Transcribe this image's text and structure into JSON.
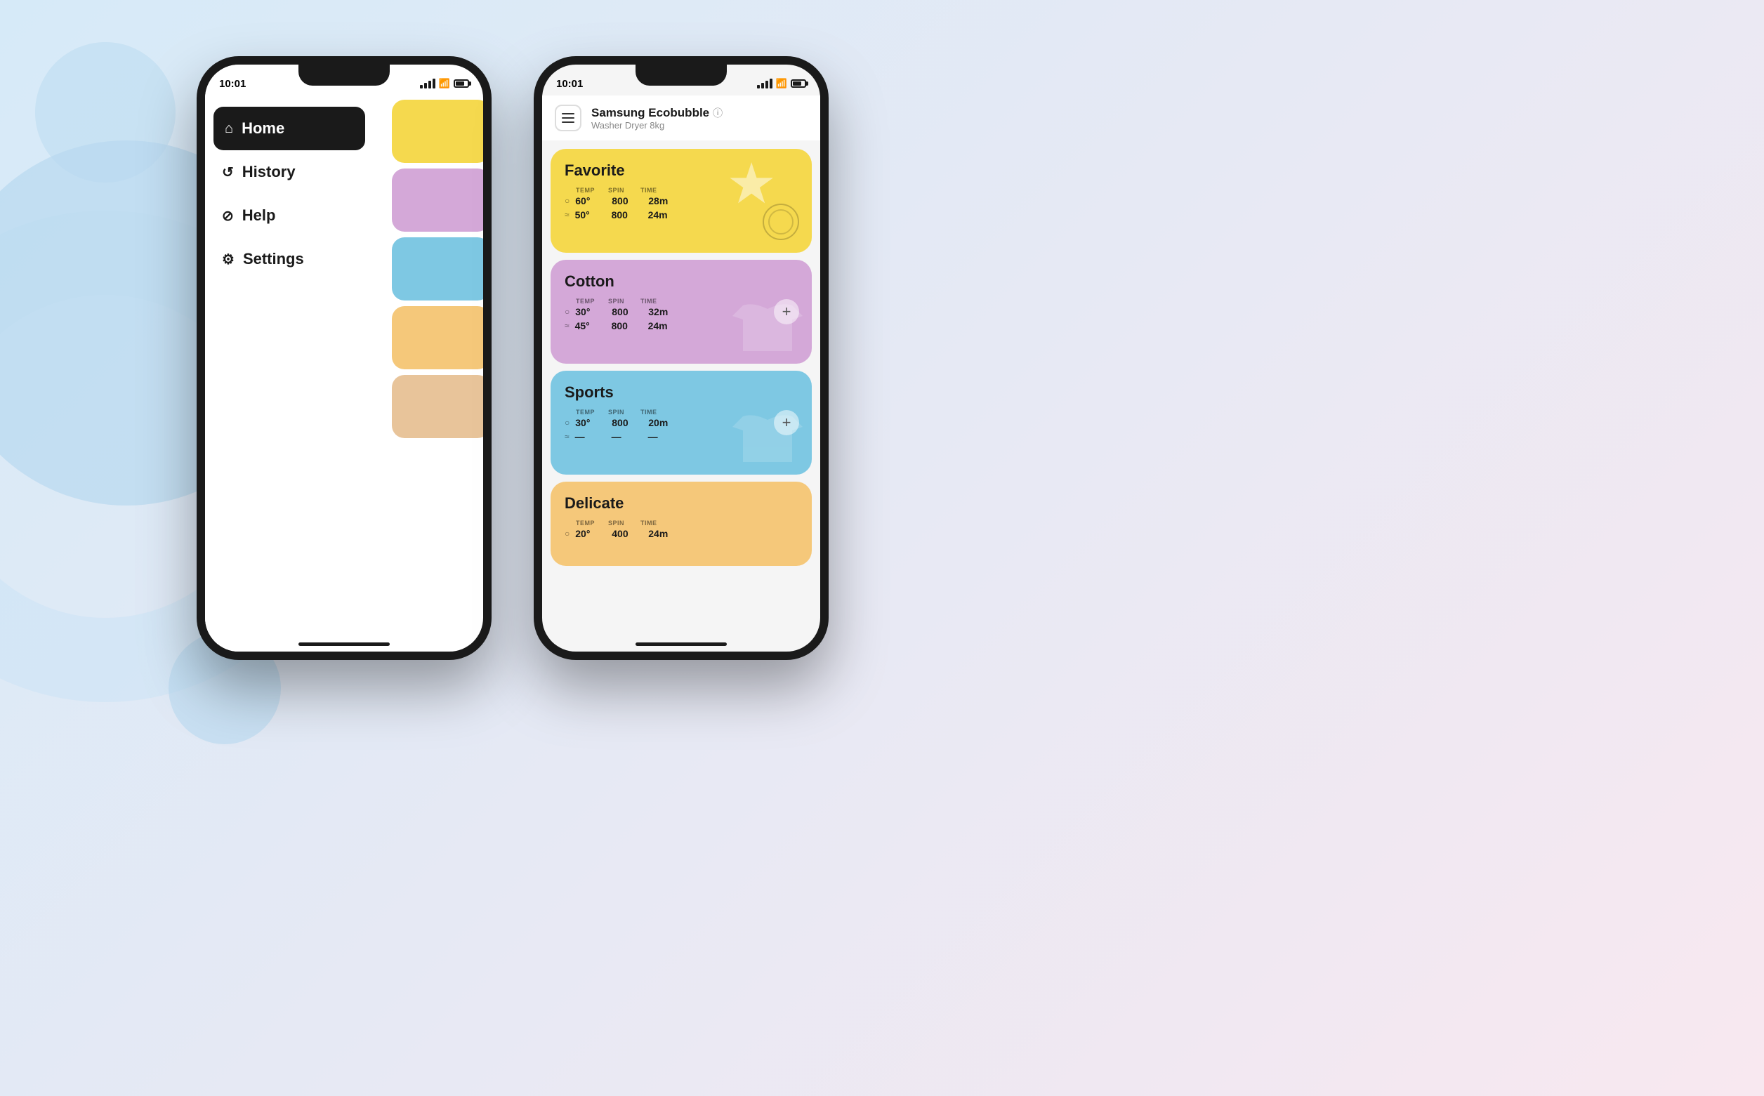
{
  "background": {
    "gradient_start": "#d6eaf8",
    "gradient_end": "#f8e8f0"
  },
  "phone1": {
    "status_bar": {
      "time": "10:01",
      "signal": "●●●",
      "wifi": "wifi",
      "battery": "battery"
    },
    "menu": {
      "items": [
        {
          "id": "home",
          "label": "Home",
          "icon": "⌂",
          "active": true
        },
        {
          "id": "history",
          "label": "History",
          "icon": "↺",
          "active": false
        },
        {
          "id": "help",
          "label": "Help",
          "icon": "?",
          "active": false
        },
        {
          "id": "settings",
          "label": "Settings",
          "icon": "⚙",
          "active": false
        }
      ]
    }
  },
  "phone2": {
    "status_bar": {
      "time": "10:01"
    },
    "header": {
      "device_name": "Samsung Ecobubble",
      "device_type": "Washer Dryer 8kg",
      "menu_label": "menu"
    },
    "cards": [
      {
        "id": "favorite",
        "title": "Favorite",
        "color": "#f5d94e",
        "stat_headers": [
          "TEMP",
          "SPIN",
          "TIME"
        ],
        "rows": [
          {
            "icon": "○",
            "temp": "60°",
            "spin": "800",
            "time": "28m"
          },
          {
            "icon": "≈",
            "temp": "50°",
            "spin": "800",
            "time": "24m"
          }
        ],
        "action": "spin-icon"
      },
      {
        "id": "cotton",
        "title": "Cotton",
        "color": "#d4a8d8",
        "stat_headers": [
          "TEMP",
          "SPIN",
          "TIME"
        ],
        "rows": [
          {
            "icon": "○",
            "temp": "30°",
            "spin": "800",
            "time": "32m"
          },
          {
            "icon": "≈",
            "temp": "45°",
            "spin": "800",
            "time": "24m"
          }
        ],
        "action": "plus"
      },
      {
        "id": "sports",
        "title": "Sports",
        "color": "#7ec8e3",
        "stat_headers": [
          "TEMP",
          "SPIN",
          "TIME"
        ],
        "rows": [
          {
            "icon": "○",
            "temp": "30°",
            "spin": "800",
            "time": "20m"
          },
          {
            "icon": "≈",
            "temp": "—",
            "spin": "—",
            "time": "—"
          }
        ],
        "action": "plus"
      },
      {
        "id": "delicate",
        "title": "Delicate",
        "color": "#f5c87a",
        "stat_headers": [
          "TEMP",
          "SPIN",
          "TIME"
        ],
        "rows": [
          {
            "icon": "○",
            "temp": "20°",
            "spin": "400",
            "time": "24m"
          }
        ],
        "action": "none"
      }
    ]
  }
}
